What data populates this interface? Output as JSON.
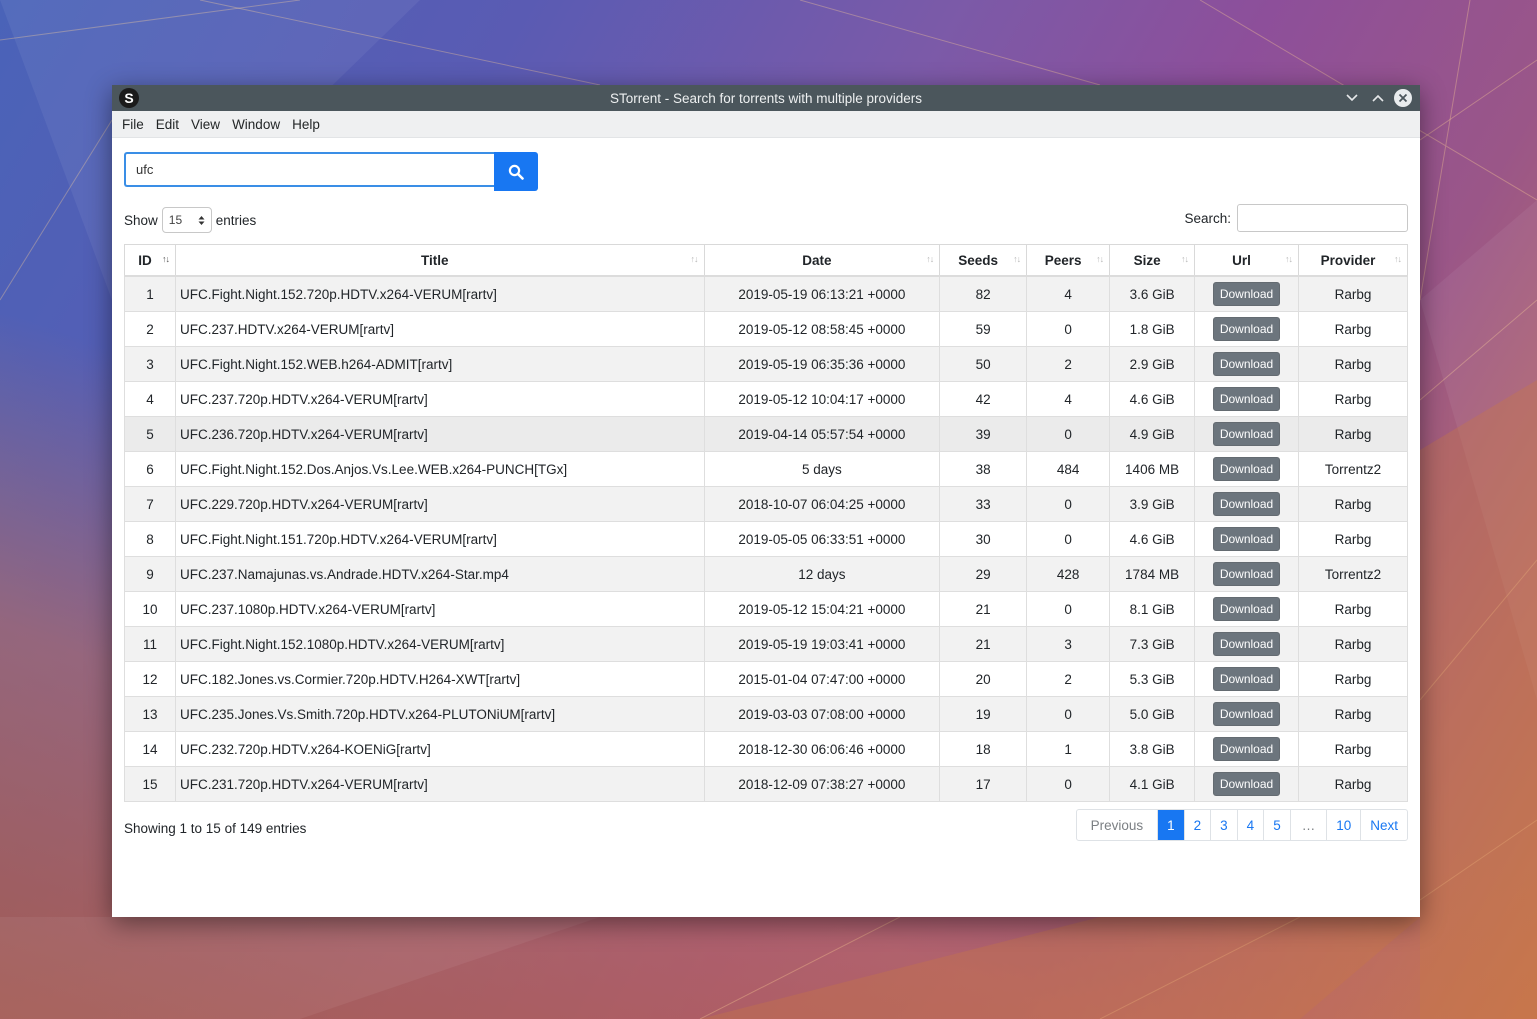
{
  "window": {
    "app_icon_letter": "S",
    "title": "STorrent - Search for torrents with multiple providers",
    "minimize_glyph": "⌄",
    "maximize_glyph": "⌃",
    "close_glyph": "✕"
  },
  "menu": [
    "File",
    "Edit",
    "View",
    "Window",
    "Help"
  ],
  "search": {
    "value": "ufc"
  },
  "length_control": {
    "prefix": "Show",
    "value": "15",
    "suffix": "entries"
  },
  "filter": {
    "label": "Search:",
    "value": ""
  },
  "columns": [
    "ID",
    "Title",
    "Date",
    "Seeds",
    "Peers",
    "Size",
    "Url",
    "Provider"
  ],
  "rows": [
    {
      "id": "1",
      "title": "UFC.Fight.Night.152.720p.HDTV.x264-VERUM[rartv]",
      "date": "2019-05-19 06:13:21 +0000",
      "seeds": "82",
      "peers": "4",
      "size": "3.6 GiB",
      "url": "Download",
      "provider": "Rarbg"
    },
    {
      "id": "2",
      "title": "UFC.237.HDTV.x264-VERUM[rartv]",
      "date": "2019-05-12 08:58:45 +0000",
      "seeds": "59",
      "peers": "0",
      "size": "1.8 GiB",
      "url": "Download",
      "provider": "Rarbg"
    },
    {
      "id": "3",
      "title": "UFC.Fight.Night.152.WEB.h264-ADMIT[rartv]",
      "date": "2019-05-19 06:35:36 +0000",
      "seeds": "50",
      "peers": "2",
      "size": "2.9 GiB",
      "url": "Download",
      "provider": "Rarbg"
    },
    {
      "id": "4",
      "title": "UFC.237.720p.HDTV.x264-VERUM[rartv]",
      "date": "2019-05-12 10:04:17 +0000",
      "seeds": "42",
      "peers": "4",
      "size": "4.6 GiB",
      "url": "Download",
      "provider": "Rarbg"
    },
    {
      "id": "5",
      "title": "UFC.236.720p.HDTV.x264-VERUM[rartv]",
      "date": "2019-04-14 05:57:54 +0000",
      "seeds": "39",
      "peers": "0",
      "size": "4.9 GiB",
      "url": "Download",
      "provider": "Rarbg"
    },
    {
      "id": "6",
      "title": "UFC.Fight.Night.152.Dos.Anjos.Vs.Lee.WEB.x264-PUNCH[TGx]",
      "date": "5 days",
      "seeds": "38",
      "peers": "484",
      "size": "1406 MB",
      "url": "Download",
      "provider": "Torrentz2"
    },
    {
      "id": "7",
      "title": "UFC.229.720p.HDTV.x264-VERUM[rartv]",
      "date": "2018-10-07 06:04:25 +0000",
      "seeds": "33",
      "peers": "0",
      "size": "3.9 GiB",
      "url": "Download",
      "provider": "Rarbg"
    },
    {
      "id": "8",
      "title": "UFC.Fight.Night.151.720p.HDTV.x264-VERUM[rartv]",
      "date": "2019-05-05 06:33:51 +0000",
      "seeds": "30",
      "peers": "0",
      "size": "4.6 GiB",
      "url": "Download",
      "provider": "Rarbg"
    },
    {
      "id": "9",
      "title": "UFC.237.Namajunas.vs.Andrade.HDTV.x264-Star.mp4",
      "date": "12 days",
      "seeds": "29",
      "peers": "428",
      "size": "1784 MB",
      "url": "Download",
      "provider": "Torrentz2"
    },
    {
      "id": "10",
      "title": "UFC.237.1080p.HDTV.x264-VERUM[rartv]",
      "date": "2019-05-12 15:04:21 +0000",
      "seeds": "21",
      "peers": "0",
      "size": "8.1 GiB",
      "url": "Download",
      "provider": "Rarbg"
    },
    {
      "id": "11",
      "title": "UFC.Fight.Night.152.1080p.HDTV.x264-VERUM[rartv]",
      "date": "2019-05-19 19:03:41 +0000",
      "seeds": "21",
      "peers": "3",
      "size": "7.3 GiB",
      "url": "Download",
      "provider": "Rarbg"
    },
    {
      "id": "12",
      "title": "UFC.182.Jones.vs.Cormier.720p.HDTV.H264-XWT[rartv]",
      "date": "2015-01-04 07:47:00 +0000",
      "seeds": "20",
      "peers": "2",
      "size": "5.3 GiB",
      "url": "Download",
      "provider": "Rarbg"
    },
    {
      "id": "13",
      "title": "UFC.235.Jones.Vs.Smith.720p.HDTV.x264-PLUTONiUM[rartv]",
      "date": "2019-03-03 07:08:00 +0000",
      "seeds": "19",
      "peers": "0",
      "size": "5.0 GiB",
      "url": "Download",
      "provider": "Rarbg"
    },
    {
      "id": "14",
      "title": "UFC.232.720p.HDTV.x264-KOENiG[rartv]",
      "date": "2018-12-30 06:06:46 +0000",
      "seeds": "18",
      "peers": "1",
      "size": "3.8 GiB",
      "url": "Download",
      "provider": "Rarbg"
    },
    {
      "id": "15",
      "title": "UFC.231.720p.HDTV.x264-VERUM[rartv]",
      "date": "2018-12-09 07:38:27 +0000",
      "seeds": "17",
      "peers": "0",
      "size": "4.1 GiB",
      "url": "Download",
      "provider": "Rarbg"
    }
  ],
  "info": "Showing 1 to 15 of 149 entries",
  "pagination": {
    "previous": "Previous",
    "pages": [
      "1",
      "2",
      "3",
      "4",
      "5"
    ],
    "ellipsis": "…",
    "last": "10",
    "next": "Next",
    "active": "1"
  },
  "colors": {
    "accent": "#1877f2",
    "download_button": "#6c757d",
    "titlebar": "#4b565c"
  }
}
